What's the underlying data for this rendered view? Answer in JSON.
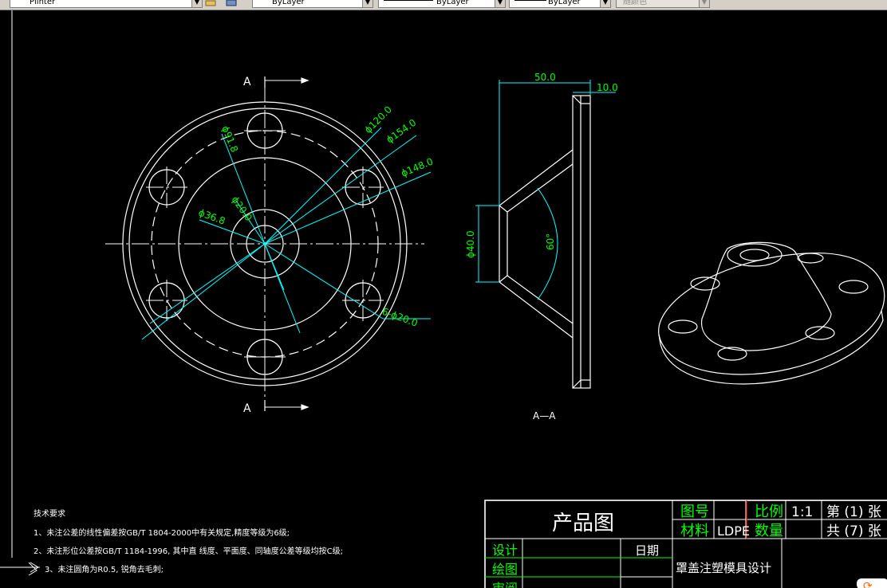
{
  "toolbar": {
    "layer_combo": "Plinter",
    "color_combo": "ByLayer",
    "linetype_combo": "ByLayer",
    "lineweight_combo": "ByLayer",
    "plotstyle_combo": "随颜色"
  },
  "drawing": {
    "section_marker": "A",
    "section_label": "A—A",
    "dims": {
      "d120": "ϕ120.0",
      "d154": "ϕ154.0",
      "d148": "ϕ148.0",
      "d91_8": "ϕ91.8",
      "d20_center": "ϕ20.0",
      "d36_8": "ϕ36.8",
      "holes": "6-ϕ20.0",
      "len50": "50.0",
      "thk10": "10.0",
      "d40": "ϕ40.0",
      "angle": "60°"
    }
  },
  "notes": {
    "heading": "技术要求",
    "lines": [
      "1、未注公差的线性偏差按GB/T 1804-2000中有关规定,精度等级为6级;",
      "2、未注形位公差按GB/T 1184-1996, 其中直 线度、平面度、同轴度公差等级均按C级;",
      "3、未注圆角为R0.5, 锐角去毛刺;"
    ]
  },
  "title_block": {
    "title": "产品图",
    "drawing_no_label": "图号",
    "scale_label": "比例",
    "scale_value": "1:1",
    "sheet": "第 (1) 张",
    "material_label": "材料",
    "material_value": "LDPE",
    "qty_label": "数量",
    "total": "共 (7) 张",
    "design_label": "设计",
    "date_label": "日期",
    "drawn_label": "绘图",
    "review_label": "审阅",
    "project": "罩盖注塑模具设计"
  },
  "colors": {
    "background": "#000000",
    "geometry": "#ffffff",
    "dimension": "#00ffff",
    "dim_text": "#00ff00",
    "border": "#ffffff",
    "red_divider": "#ff0000"
  }
}
